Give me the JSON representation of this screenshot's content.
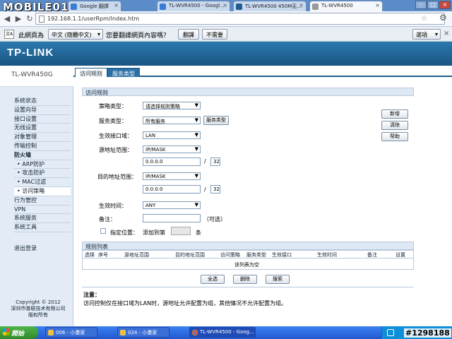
{
  "browser": {
    "logo": "MOBILE01",
    "tabs": [
      {
        "label": "Google 翻譯"
      },
      {
        "label": "TL-WVR4500 - Googl..."
      },
      {
        "label": "TL-WVR4500 450M无..."
      },
      {
        "label": "TL-WVR4500"
      }
    ],
    "url": "192.168.1.1/userRpm/Index.htm",
    "translate": {
      "icon_label": "文A",
      "prefix": "此網頁為",
      "language": "中文 (簡體中文)",
      "question": "您要翻譯網頁內容嗎？",
      "translate_button": "翻譯",
      "nope_button": "不需要",
      "options_button": "選項"
    }
  },
  "router": {
    "brand": "TP-LINK",
    "model": "TL-WVR450G",
    "menu": [
      {
        "label": "系统状态"
      },
      {
        "label": "设置向导"
      },
      {
        "label": "接口设置"
      },
      {
        "label": "无线设置"
      },
      {
        "label": "对象管理"
      },
      {
        "label": "传输控制"
      },
      {
        "label": "防火墙"
      },
      {
        "label": "• ARP防护"
      },
      {
        "label": "• 攻击防护"
      },
      {
        "label": "• MAC过滤"
      },
      {
        "label": "• 访问策略"
      },
      {
        "label": "行为管控"
      },
      {
        "label": "VPN"
      },
      {
        "label": "系统服务"
      },
      {
        "label": "系统工具"
      },
      {
        "label": "退出登录"
      }
    ],
    "copyright": {
      "line1": "Copyright © 2012",
      "line2": "深圳市普联技术有限公司",
      "line3": "版权所有"
    },
    "tabs": [
      {
        "label": "访问规则"
      },
      {
        "label": "服务类型"
      }
    ],
    "form": {
      "section_title": "访问规则",
      "policy_label": "策略类型：",
      "policy_value": "请选择规则策略",
      "service_label": "服务类型：",
      "service_value": "所有服务",
      "service_type_button": "服务类型",
      "iface_label": "生效接口域：",
      "iface_value": "LAN",
      "src_label": "源地址范围：",
      "src_mode": "IP/MASK",
      "src_ip": "0.0.0.0",
      "src_mask": "32",
      "dst_label": "目的地址范围：",
      "dst_mode": "IP/MASK",
      "dst_ip": "0.0.0.0",
      "dst_mask": "32",
      "time_label": "生效时间：",
      "time_value": "ANY",
      "remark_label": "备注：",
      "remark_value": "",
      "optional": "（可选）",
      "position_label": "指定位置：",
      "add_to_label": "添加到第",
      "row_suffix": "条",
      "slash": "/",
      "add_button": "新增",
      "clear_button": "清除",
      "help_button": "帮助"
    },
    "rule_list": {
      "section_title": "规则列表",
      "columns": [
        "选择",
        "序号",
        "源地址范围",
        "目的地址范围",
        "访问策略",
        "服务类型",
        "生效接口",
        "生效时间",
        "备注",
        "设置"
      ],
      "empty_text": "该列表为空",
      "select_all_button": "全选",
      "delete_button": "删除",
      "search_button": "搜索"
    },
    "note": {
      "title": "注意：",
      "text": "访问控制仅在接口域为LAN时，源地址允许配置为组，其他情况不允许配置为组。"
    }
  },
  "taskbar": {
    "start": "開始",
    "tasks": [
      {
        "label": "006 - 小畫家"
      },
      {
        "label": "024 - 小畫家"
      },
      {
        "label": "TL-WVR4500 - Goog..."
      }
    ],
    "watermark": "#1298188"
  }
}
